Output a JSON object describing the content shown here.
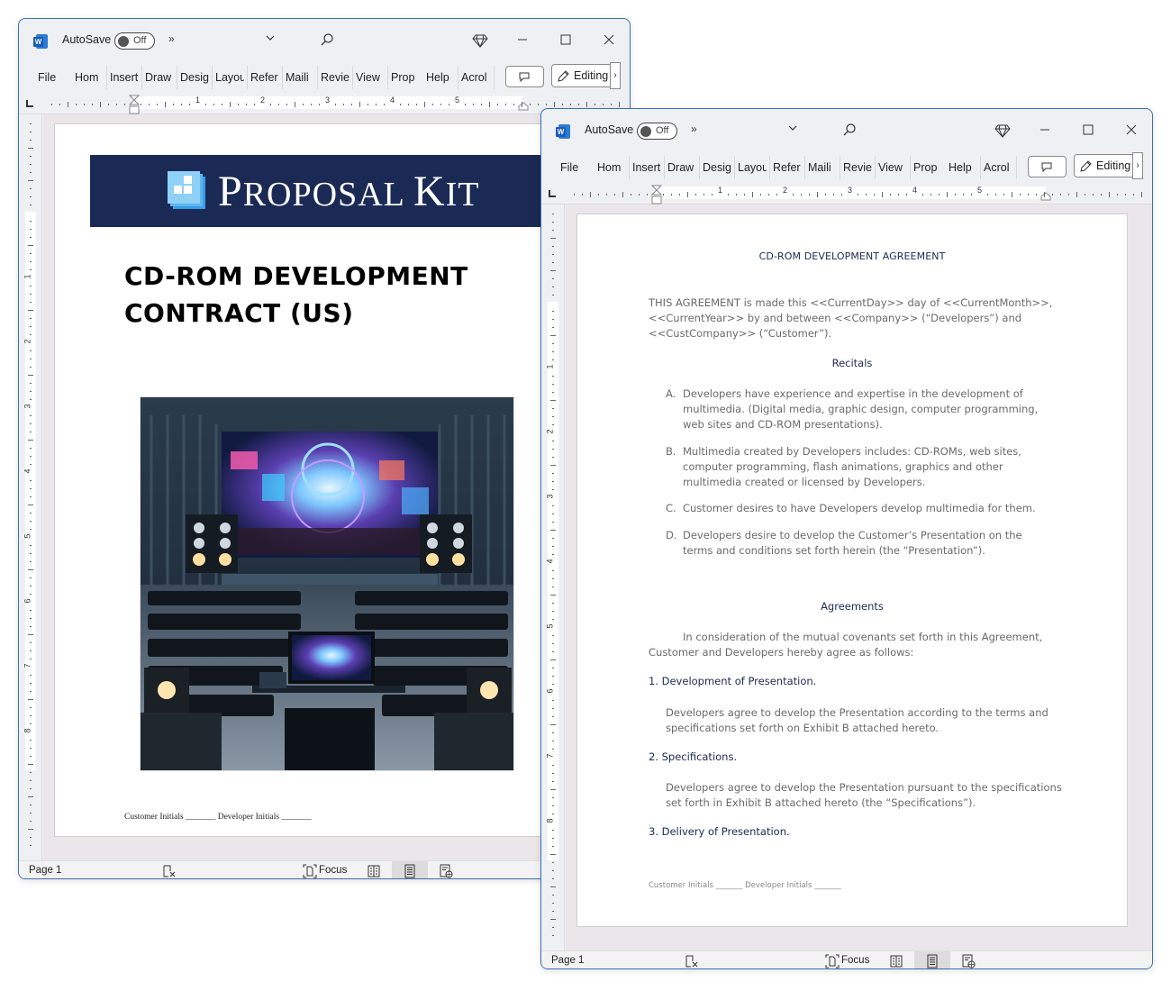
{
  "windows": [
    {
      "app_icon": "word-icon",
      "autosave_label": "AutoSave",
      "autosave_state": "Off",
      "more_commands": "»",
      "ribbon_tabs": [
        "File",
        "Home",
        "Insert",
        "Draw",
        "Design",
        "Layout",
        "References",
        "Mailings",
        "Review",
        "View",
        "Properties",
        "Help",
        "Acrobat"
      ],
      "ribbon_tabs_visible": [
        "File",
        "Hom",
        "Insert",
        "Draw",
        "Desig",
        "Layou",
        "Refer",
        "Maili",
        "Revie",
        "View",
        "Prop",
        "Help",
        "Acrol"
      ],
      "editing_label": "Editing",
      "ruler_numbers": [
        "1",
        "2",
        "3",
        "4",
        "5"
      ],
      "vruler_numbers": [
        "1",
        "2",
        "3",
        "4",
        "5",
        "6",
        "7",
        "8"
      ],
      "status": {
        "page": "Page 1",
        "focus": "Focus"
      }
    },
    {
      "app_icon": "word-icon",
      "autosave_label": "AutoSave",
      "autosave_state": "Off",
      "more_commands": "»",
      "ribbon_tabs_visible": [
        "File",
        "Hom",
        "Insert",
        "Draw",
        "Desig",
        "Layou",
        "Refer",
        "Maili",
        "Revie",
        "View",
        "Prop",
        "Help",
        "Acrol"
      ],
      "editing_label": "Editing",
      "ruler_numbers": [
        "1",
        "2",
        "3",
        "4",
        "5"
      ],
      "vruler_numbers": [
        "1",
        "2",
        "3",
        "4",
        "5",
        "6",
        "7",
        "8"
      ],
      "status": {
        "page": "Page 1",
        "focus": "Focus"
      }
    }
  ],
  "cover": {
    "brand_first": "P",
    "brand_rest": "ROPOSAL ",
    "brand_k": "K",
    "brand_end": "IT",
    "title_line1": "CD-ROM DEVELOPMENT",
    "title_line2": "CONTRACT (US)",
    "image_alt": "Multimedia theater with large screen, speakers, seating and workstation",
    "initials": "Customer Initials _______ Developer Initials _______"
  },
  "agreement": {
    "title": "CD-ROM DEVELOPMENT AGREEMENT",
    "intro": "THIS AGREEMENT is made this <<CurrentDay>> day of <<CurrentMonth>>, <<CurrentYear>> by and between <<Company>> (“Developers”) and <<CustCompany>> (“Customer”).",
    "recitals_heading": "Recitals",
    "recitals": [
      {
        "letter": "A.",
        "text": "Developers have experience and expertise in the development of multimedia. (Digital media, graphic design, computer programming, web sites and CD-ROM presentations)."
      },
      {
        "letter": "B.",
        "text": "Multimedia created by Developers includes: CD-ROMs, web sites, computer programming, flash animations, graphics and other multimedia created or licensed by Developers."
      },
      {
        "letter": "C.",
        "text": "Customer desires to have Developers develop multimedia for them."
      },
      {
        "letter": "D.",
        "text": "Developers desire to develop the Customer’s Presentation on the terms and conditions set forth herein (the “Presentation”)."
      }
    ],
    "agreements_heading": "Agreements",
    "agreements_intro": "In consideration of the mutual covenants set forth in this Agreement, Customer and Developers hereby agree as follows:",
    "sections": [
      {
        "heading": "1. Development of Presentation.",
        "body": "Developers agree to develop the Presentation according to the terms and specifications set forth on Exhibit B attached hereto."
      },
      {
        "heading": "2. Specifications.",
        "body": "Developers agree to develop the Presentation pursuant to the specifications set forth in Exhibit B attached hereto (the “Specifications”)."
      },
      {
        "heading": "3. Delivery of Presentation.",
        "body": ""
      }
    ],
    "initials": "Customer Initials _______ Developer Initials _______"
  },
  "colors": {
    "word_blue": "#185abd",
    "window_border": "#3a6fb0",
    "banner_navy": "#1b2a55",
    "heading_navy": "#1b2a55",
    "body_gray": "#6a6a6a"
  }
}
